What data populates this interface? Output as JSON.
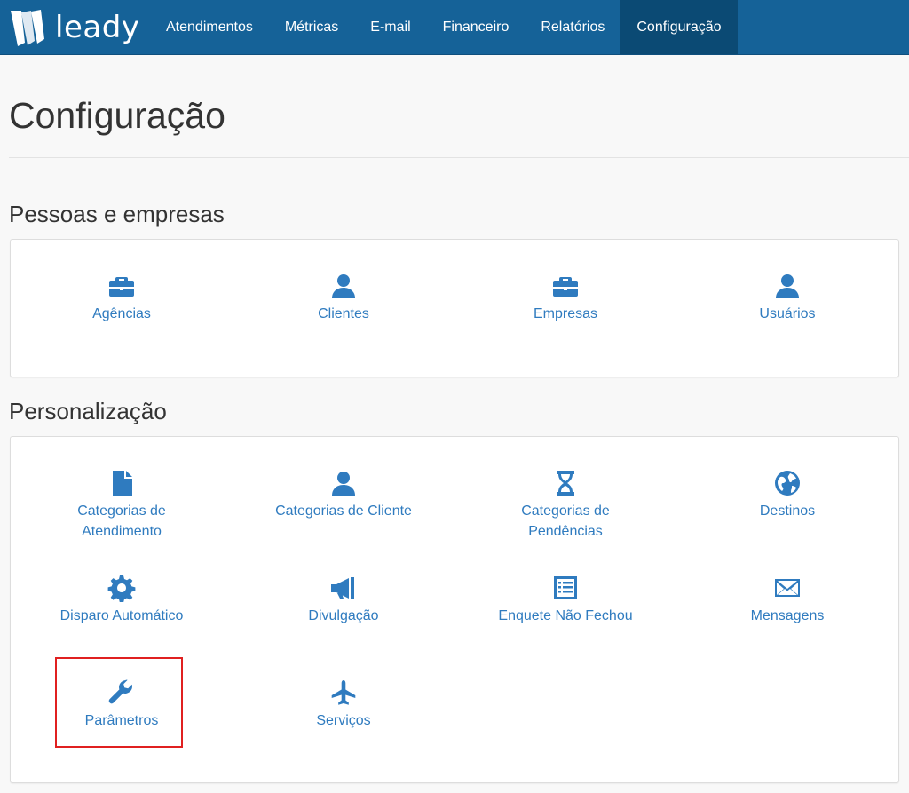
{
  "brand": {
    "name": "leady",
    "logo_icon": "leady-logo-icon"
  },
  "nav": {
    "items": [
      {
        "label": "Atendimentos",
        "active": false
      },
      {
        "label": "Métricas",
        "active": false
      },
      {
        "label": "E-mail",
        "active": false
      },
      {
        "label": "Financeiro",
        "active": false
      },
      {
        "label": "Relatórios",
        "active": false
      },
      {
        "label": "Configuração",
        "active": true
      }
    ]
  },
  "page": {
    "title": "Configuração"
  },
  "sections": [
    {
      "heading": "Pessoas e empresas",
      "items": [
        {
          "label": "Agências",
          "icon": "briefcase-icon"
        },
        {
          "label": "Clientes",
          "icon": "user-icon"
        },
        {
          "label": "Empresas",
          "icon": "briefcase-icon"
        },
        {
          "label": "Usuários",
          "icon": "user-icon"
        }
      ]
    },
    {
      "heading": "Personalização",
      "items": [
        {
          "label": "Categorias de Atendimento",
          "icon": "file-icon"
        },
        {
          "label": "Categorias de Cliente",
          "icon": "user-icon"
        },
        {
          "label": "Categorias de Pendências",
          "icon": "hourglass-icon"
        },
        {
          "label": "Destinos",
          "icon": "globe-icon"
        },
        {
          "label": "Disparo Automático",
          "icon": "gear-icon"
        },
        {
          "label": "Divulgação",
          "icon": "megaphone-icon"
        },
        {
          "label": "Enquete Não Fechou",
          "icon": "list-icon"
        },
        {
          "label": "Mensagens",
          "icon": "envelope-icon"
        },
        {
          "label": "Parâmetros",
          "icon": "wrench-icon",
          "highlighted": true
        },
        {
          "label": "Serviços",
          "icon": "plane-icon"
        }
      ]
    }
  ],
  "colors": {
    "navbar": "#156298",
    "nav_active": "#0b4a74",
    "link": "#2f7bbf",
    "highlight_border": "#e02020"
  }
}
